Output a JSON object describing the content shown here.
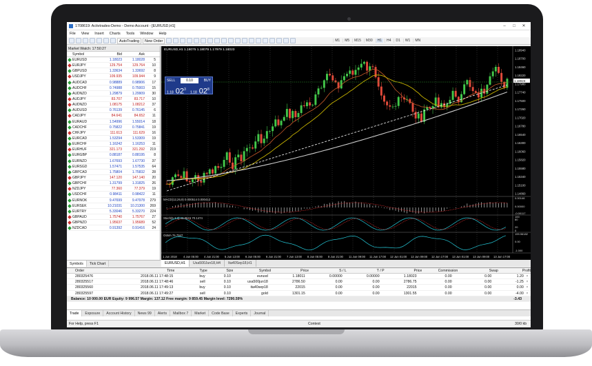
{
  "window": {
    "title": "1708619: Activtrades-Demo - Demo Account - [EURUSD,H1]"
  },
  "menu": [
    "File",
    "View",
    "Insert",
    "Charts",
    "Tools",
    "Window",
    "Help"
  ],
  "toolbar": {
    "autotrading": "AutoTrading",
    "new_order": "New Order",
    "timeframes": [
      "M1",
      "M5",
      "M15",
      "M30",
      "H1",
      "H4",
      "D1",
      "W1",
      "MN"
    ]
  },
  "market_watch": {
    "title": "Market Watch: 17:50:27",
    "headers": [
      "Symbol",
      "Bid",
      "Ask",
      ""
    ],
    "rows": [
      {
        "s": "EURUSD",
        "b": "1.18023",
        "a": "1.18028",
        "p": "5",
        "d": "up"
      },
      {
        "s": "EURJPY",
        "b": "129.754",
        "a": "129.764",
        "p": "10",
        "d": "down"
      },
      {
        "s": "GBPUSD",
        "b": "1.33634",
        "a": "1.33692",
        "p": "8",
        "d": "up"
      },
      {
        "s": "USDJPY",
        "b": "109.935",
        "a": "109.944",
        "p": "9",
        "d": "down"
      },
      {
        "s": "AUDCAD",
        "b": "0.98889",
        "a": "0.98906",
        "a2": "",
        "p": "17",
        "d": "up"
      },
      {
        "s": "AUDCHF",
        "b": "0.74988",
        "a": "0.75003",
        "p": "15",
        "d": "up"
      },
      {
        "s": "AUDNZD",
        "b": "1.29879",
        "a": "1.29909",
        "p": "30",
        "d": "up"
      },
      {
        "s": "AUDJPY",
        "b": "83.707",
        "a": "83.717",
        "p": "10",
        "d": "down"
      },
      {
        "s": "AUDNZD",
        "b": "1.08175",
        "a": "1.08212",
        "p": "37",
        "d": "down"
      },
      {
        "s": "AUDUSD",
        "b": "0.76139",
        "a": "0.76145",
        "p": "6",
        "d": "up"
      },
      {
        "s": "CADJPY",
        "b": "84.641",
        "a": "84.652",
        "p": "11",
        "d": "down"
      },
      {
        "s": "EURAUD",
        "b": "1.54996",
        "a": "1.55014",
        "p": "18",
        "d": "up"
      },
      {
        "s": "CADCHF",
        "b": "0.75822",
        "a": "0.75841",
        "p": "19",
        "d": "up"
      },
      {
        "s": "CHFJPY",
        "b": "111.613",
        "a": "111.629",
        "p": "16",
        "d": "down"
      },
      {
        "s": "EURCAD",
        "b": "1.53294",
        "a": "1.53309",
        "p": "19",
        "d": "up"
      },
      {
        "s": "EURCHF",
        "b": "1.16242",
        "a": "1.16253",
        "p": "11",
        "d": "up"
      },
      {
        "s": "EURHUF",
        "b": "321.173",
        "a": "321.292",
        "p": "219",
        "d": "down"
      },
      {
        "s": "EURGBP",
        "b": "0.88187",
        "a": "0.88195",
        "p": "8",
        "d": "up"
      },
      {
        "s": "EURNZD",
        "b": "1.67693",
        "a": "1.67730",
        "p": "37",
        "d": "up"
      },
      {
        "s": "EURSGD",
        "b": "1.57471",
        "a": "1.57535",
        "p": "64",
        "d": "up"
      },
      {
        "s": "GBPCAD",
        "b": "1.75804",
        "a": "1.75832",
        "p": "28",
        "d": "up"
      },
      {
        "s": "GBPJPY",
        "b": "147.120",
        "a": "147.140",
        "p": "20",
        "d": "down"
      },
      {
        "s": "GBPCHF",
        "b": "1.31799",
        "a": "1.31825",
        "p": "26",
        "d": "up"
      },
      {
        "s": "NZDJPY",
        "b": "77.360",
        "a": "77.379",
        "p": "19",
        "d": "down"
      },
      {
        "s": "USDCHF",
        "b": "0.98411",
        "a": "0.98422",
        "p": "11",
        "d": "up"
      },
      {
        "s": "EURNOK",
        "b": "9.47699",
        "a": "9.47978",
        "p": "279",
        "d": "up"
      },
      {
        "s": "EURSEK",
        "b": "10.21031",
        "a": "10.21300",
        "p": "269",
        "d": "up"
      },
      {
        "s": "EURTRY",
        "b": "5.33046",
        "a": "5.33270",
        "p": "224",
        "d": "up"
      },
      {
        "s": "GBPAUD",
        "b": "1.75740",
        "a": "1.75767",
        "p": "27",
        "d": "down"
      },
      {
        "s": "GBPNZD",
        "b": "1.95637",
        "a": "1.95689",
        "p": "52",
        "d": "down"
      },
      {
        "s": "NZDCAD",
        "b": "0.91392",
        "a": "0.91416",
        "p": "24",
        "d": "up"
      }
    ],
    "tabs": [
      "Symbols",
      "Tick Chart"
    ]
  },
  "chart": {
    "header": "EURUSD,H1  1.18075 1.18079 1.17979 1.18023",
    "trade_panel": {
      "sell": "SELL",
      "buy": "BUY",
      "lot": "0.10",
      "sell_small": "1.18",
      "sell_big": "02",
      "sell_sup": "3",
      "buy_small": "1.18",
      "buy_big": "02",
      "buy_sup": "8"
    },
    "order_line": "#280325476 buy 0.10",
    "indicators": {
      "macd": "MACD(12,26,9) 0.000514 0.000412",
      "stoch": "Stoch(5,3,3) 43.8615 70.1474",
      "osma": "OsMA 76.7947"
    },
    "price_axis": [
      "1.18940",
      "1.18700",
      "1.18460",
      "1.18220",
      "1.17980",
      "1.17740",
      "1.17500",
      "1.17260",
      "1.17020",
      "1.16780",
      "1.16540",
      "1.16300",
      "1.16060",
      "1.15820",
      "1.15580",
      "1.15340",
      "1.15100",
      "1.14860"
    ],
    "current_price": "1.18023",
    "ind_axis": [
      "0.00146",
      "0.00000",
      "-0.00117",
      "100",
      "80",
      "20",
      "0",
      "199.96182",
      "0.00",
      "-1.000"
    ],
    "time_axis": [
      "1 Jun 2018",
      "4 Jun 05:00",
      "4 Jun 21:00",
      "5 Jun 13:00",
      "6 Jun 05:00",
      "6 Jun 21:00",
      "7 Jun 13:00",
      "8 Jun 05:00",
      "8 Jun 21:00",
      "11 Jun 09:00",
      "11 Jun 17:00",
      "12 Jun 01:00",
      "12 Jun 09:00",
      "12 Jun 17:00",
      "13 Jun 01:00",
      "13 Jun 09:00",
      "13 Jun 17:00"
    ],
    "tabs": [
      "EURUSD,H1",
      "Usa500Jun18,H4",
      "Ita40Sep18,H1"
    ]
  },
  "trade": {
    "headers": [
      "Order",
      "Time",
      "Type",
      "Size",
      "Symbol",
      "Price",
      "S / L",
      "T / P",
      "Price",
      "Commission",
      "Swap",
      "Profit"
    ],
    "rows": [
      [
        "280325476",
        "2018.06.11 17:48:15",
        "buy",
        "0.10",
        "eurusd",
        "1.18011",
        "0.00000",
        "0.00000",
        "1.18023",
        "0.00",
        "0.00",
        "1.20"
      ],
      [
        "280325517",
        "2018.06.11 17:48:46",
        "sell",
        "0.10",
        "usa500jun18",
        "2786.50",
        "0.00",
        "0.00",
        "2786.75",
        "0.00",
        "0.00",
        "-1.25"
      ],
      [
        "280325560",
        "2018.06.11 17:49:13",
        "buy",
        "0.10",
        "ita40sep18",
        "22015",
        "0.00",
        "0.00",
        "22015",
        "0.00",
        "0.00",
        "0.00"
      ],
      [
        "280325597",
        "2018.06.11 17:49:27",
        "sell",
        "0.10",
        "gold",
        "1301.15",
        "0.00",
        "0.00",
        "1301.55",
        "0.00",
        "0.00",
        "-4.00"
      ]
    ],
    "balance": "Balance: 10 000.00 EUR  Equity: 9 996.57  Margin: 137.12  Free margin: 9 859.45  Margin level: 7290.59%",
    "balance_profit": "-3.43",
    "tabs": [
      "Trade",
      "Exposure",
      "Account History",
      "News 99",
      "Alerts",
      "Mailbox 7",
      "Market",
      "Code Base",
      "Experts",
      "Journal"
    ]
  },
  "status": {
    "help": "For Help, press F1",
    "profile": "Contest",
    "traffic": "30/0 kb"
  },
  "colors": {
    "up": "#2e9e3a",
    "down": "#c33333",
    "grid": "#555555",
    "ma_fast": "#c8b400",
    "ma_mid": "#c85a2a",
    "ma_slow": "#cfcfcf",
    "ma_dash": "#e8e8e8"
  }
}
